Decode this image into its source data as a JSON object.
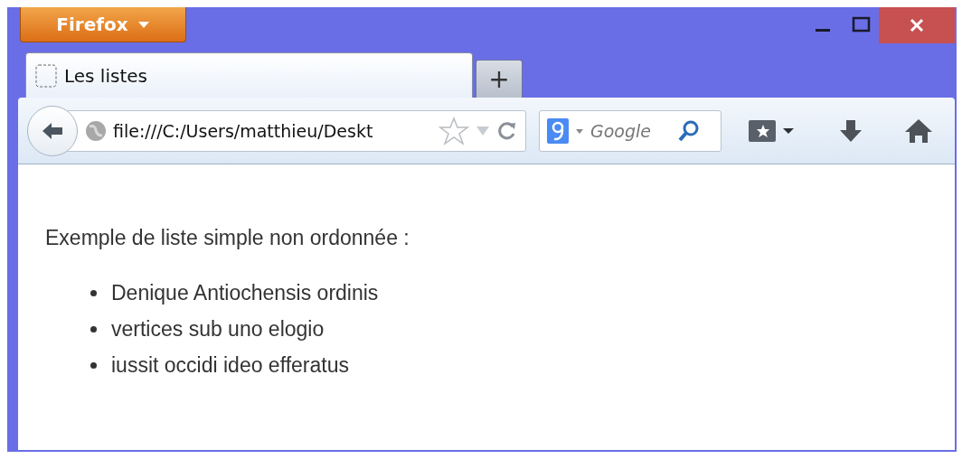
{
  "app_menu": {
    "label": "Firefox"
  },
  "tabs": [
    {
      "label": "Les listes",
      "selected": true
    }
  ],
  "new_tab": {
    "label": "+"
  },
  "address": {
    "value": "file:///C:/Users/matthieu/Deskt"
  },
  "search": {
    "placeholder": "Google"
  },
  "content": {
    "paragraph": "Exemple de liste simple non ordonnée :",
    "items": [
      "Denique Antiochensis ordinis",
      "vertices sub uno elogio",
      "iussit occidi ideo efferatus"
    ]
  }
}
